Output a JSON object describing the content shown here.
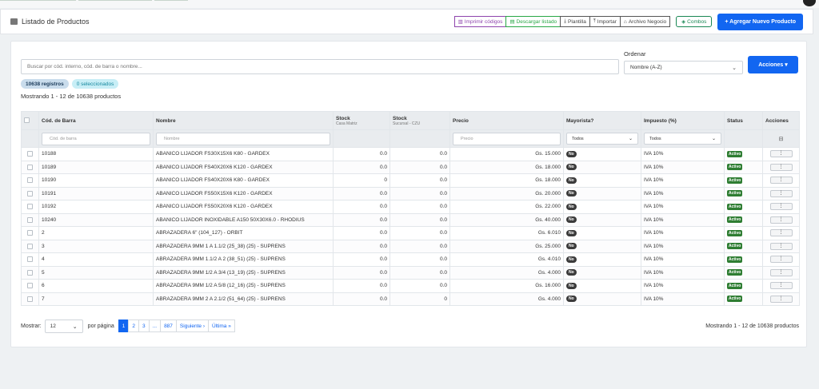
{
  "header": {
    "title": "Listado de Productos",
    "buttons": {
      "imprimir": "Imprimir códigos",
      "descargar": "Descargar listado",
      "plantilla": "Plantilla",
      "importar": "Importar",
      "archivo": "Archivo Negocio",
      "combos": "Combos",
      "agregar": "+ Agregar Nuevo Producto"
    }
  },
  "search": {
    "placeholder": "Buscar por cód. interno, cód. de barra o nombre..."
  },
  "order": {
    "label": "Ordenar",
    "value": "Nombre (A-Z)"
  },
  "actions": {
    "label": "Acciones ▾"
  },
  "badges": {
    "registros": "10638 registros",
    "seleccionados": "0 seleccionados"
  },
  "showing": "Mostrando 1 - 12 de 10638 productos",
  "table": {
    "headers": {
      "barcode": "Cód. de Barra",
      "name": "Nombre",
      "stock1": "Stock",
      "stock1_sub": "Casa Matriz",
      "stock2": "Stock",
      "stock2_sub": "Sucursal - CZU",
      "price": "Precio",
      "wholesale": "Mayorista?",
      "tax": "Impuesto (%)",
      "status": "Status",
      "actions": "Acciones"
    },
    "filters": {
      "barcode": "Cód. de barra",
      "name": "Nombre",
      "price": "Precio",
      "wholesale": "Todos",
      "tax": "Todos"
    },
    "rows": [
      {
        "barcode": "10188",
        "name": "ABANICO LIJADOR FS30X15X6 K80 - GARDEX",
        "s1": "0.0",
        "s2": "0.0",
        "price": "Gs. 15.000",
        "wholesale": "No",
        "tax": "IVA 10%",
        "status": "Activo"
      },
      {
        "barcode": "10189",
        "name": "ABANICO LIJADOR FS40X20X6 K120 - GARDEX",
        "s1": "0.0",
        "s2": "0.0",
        "price": "Gs. 18.000",
        "wholesale": "No",
        "tax": "IVA 10%",
        "status": "Activo"
      },
      {
        "barcode": "10190",
        "name": "ABANICO LIJADOR FS40X20X6 K80 - GARDEX",
        "s1": "0",
        "s2": "0.0",
        "price": "Gs. 18.000",
        "wholesale": "No",
        "tax": "IVA 10%",
        "status": "Activo"
      },
      {
        "barcode": "10191",
        "name": "ABANICO LIJADOR FS50X15X6 K120 - GARDEX",
        "s1": "0.0",
        "s2": "0.0",
        "price": "Gs. 20.000",
        "wholesale": "No",
        "tax": "IVA 10%",
        "status": "Activo"
      },
      {
        "barcode": "10192",
        "name": "ABANICO LIJADOR FS50X20X6 K120 - GARDEX",
        "s1": "0.0",
        "s2": "0.0",
        "price": "Gs. 22.000",
        "wholesale": "No",
        "tax": "IVA 10%",
        "status": "Activo"
      },
      {
        "barcode": "10240",
        "name": "ABANICO LIJADOR INOXIDABLE A150 50X30X6.0 - RHODIUS",
        "s1": "0.0",
        "s2": "0.0",
        "price": "Gs. 40.000",
        "wholesale": "No",
        "tax": "IVA 10%",
        "status": "Activo"
      },
      {
        "barcode": "2",
        "name": "ABRAZADERA 6\" (104_127) - ORBIT",
        "s1": "0.0",
        "s2": "0.0",
        "price": "Gs. 6.010",
        "wholesale": "No",
        "tax": "IVA 10%",
        "status": "Activo"
      },
      {
        "barcode": "3",
        "name": "ABRAZADERA 9MM 1 A 1.1/2 (25_38) (25) - SUPRENS",
        "s1": "0.0",
        "s2": "0.0",
        "price": "Gs. 25.000",
        "wholesale": "No",
        "tax": "IVA 10%",
        "status": "Activo"
      },
      {
        "barcode": "4",
        "name": "ABRAZADERA 9MM 1.1/2 A 2 (38_51) (25) - SUPRENS",
        "s1": "0.0",
        "s2": "0.0",
        "price": "Gs. 4.010",
        "wholesale": "No",
        "tax": "IVA 10%",
        "status": "Activo"
      },
      {
        "barcode": "5",
        "name": "ABRAZADERA 9MM 1/2 A 3/4 (13_19) (25) - SUPRENS",
        "s1": "0.0",
        "s2": "0.0",
        "price": "Gs. 4.000",
        "wholesale": "No",
        "tax": "IVA 10%",
        "status": "Activo"
      },
      {
        "barcode": "6",
        "name": "ABRAZADERA 9MM 1/2 A 5/8 (12_16) (25) - SUPRENS",
        "s1": "0.0",
        "s2": "0.0",
        "price": "Gs. 16.000",
        "wholesale": "No",
        "tax": "IVA 10%",
        "status": "Activo"
      },
      {
        "barcode": "7",
        "name": "ABRAZADERA 9MM 2 A 2.1/2 (51_64) (25) - SUPRENS",
        "s1": "0.0",
        "s2": "0",
        "price": "Gs. 4.000",
        "wholesale": "No",
        "tax": "IVA 10%",
        "status": "Activo"
      }
    ],
    "row_action": "⋮"
  },
  "footer": {
    "show_label": "Mostrar:",
    "per_page": "12",
    "per_page_label": "por página",
    "pages": [
      "1",
      "2",
      "3",
      "...",
      "887",
      "Siguiente ›",
      "Última »"
    ],
    "active_page": "1",
    "summary": "Mostrando 1 - 12 de 10638 productos"
  },
  "colors": {
    "primary": "#1266f1",
    "success": "#198754",
    "purple": "#8e44ad",
    "status_active": "#2e7d32",
    "badge_no": "#3b3b3b"
  },
  "icons": [
    "list-icon",
    "barcode-icon",
    "file-excel-icon",
    "download-icon",
    "upload-icon",
    "store-icon",
    "layers-icon",
    "columns-icon",
    "chevron-down-icon",
    "more-vertical-icon"
  ]
}
